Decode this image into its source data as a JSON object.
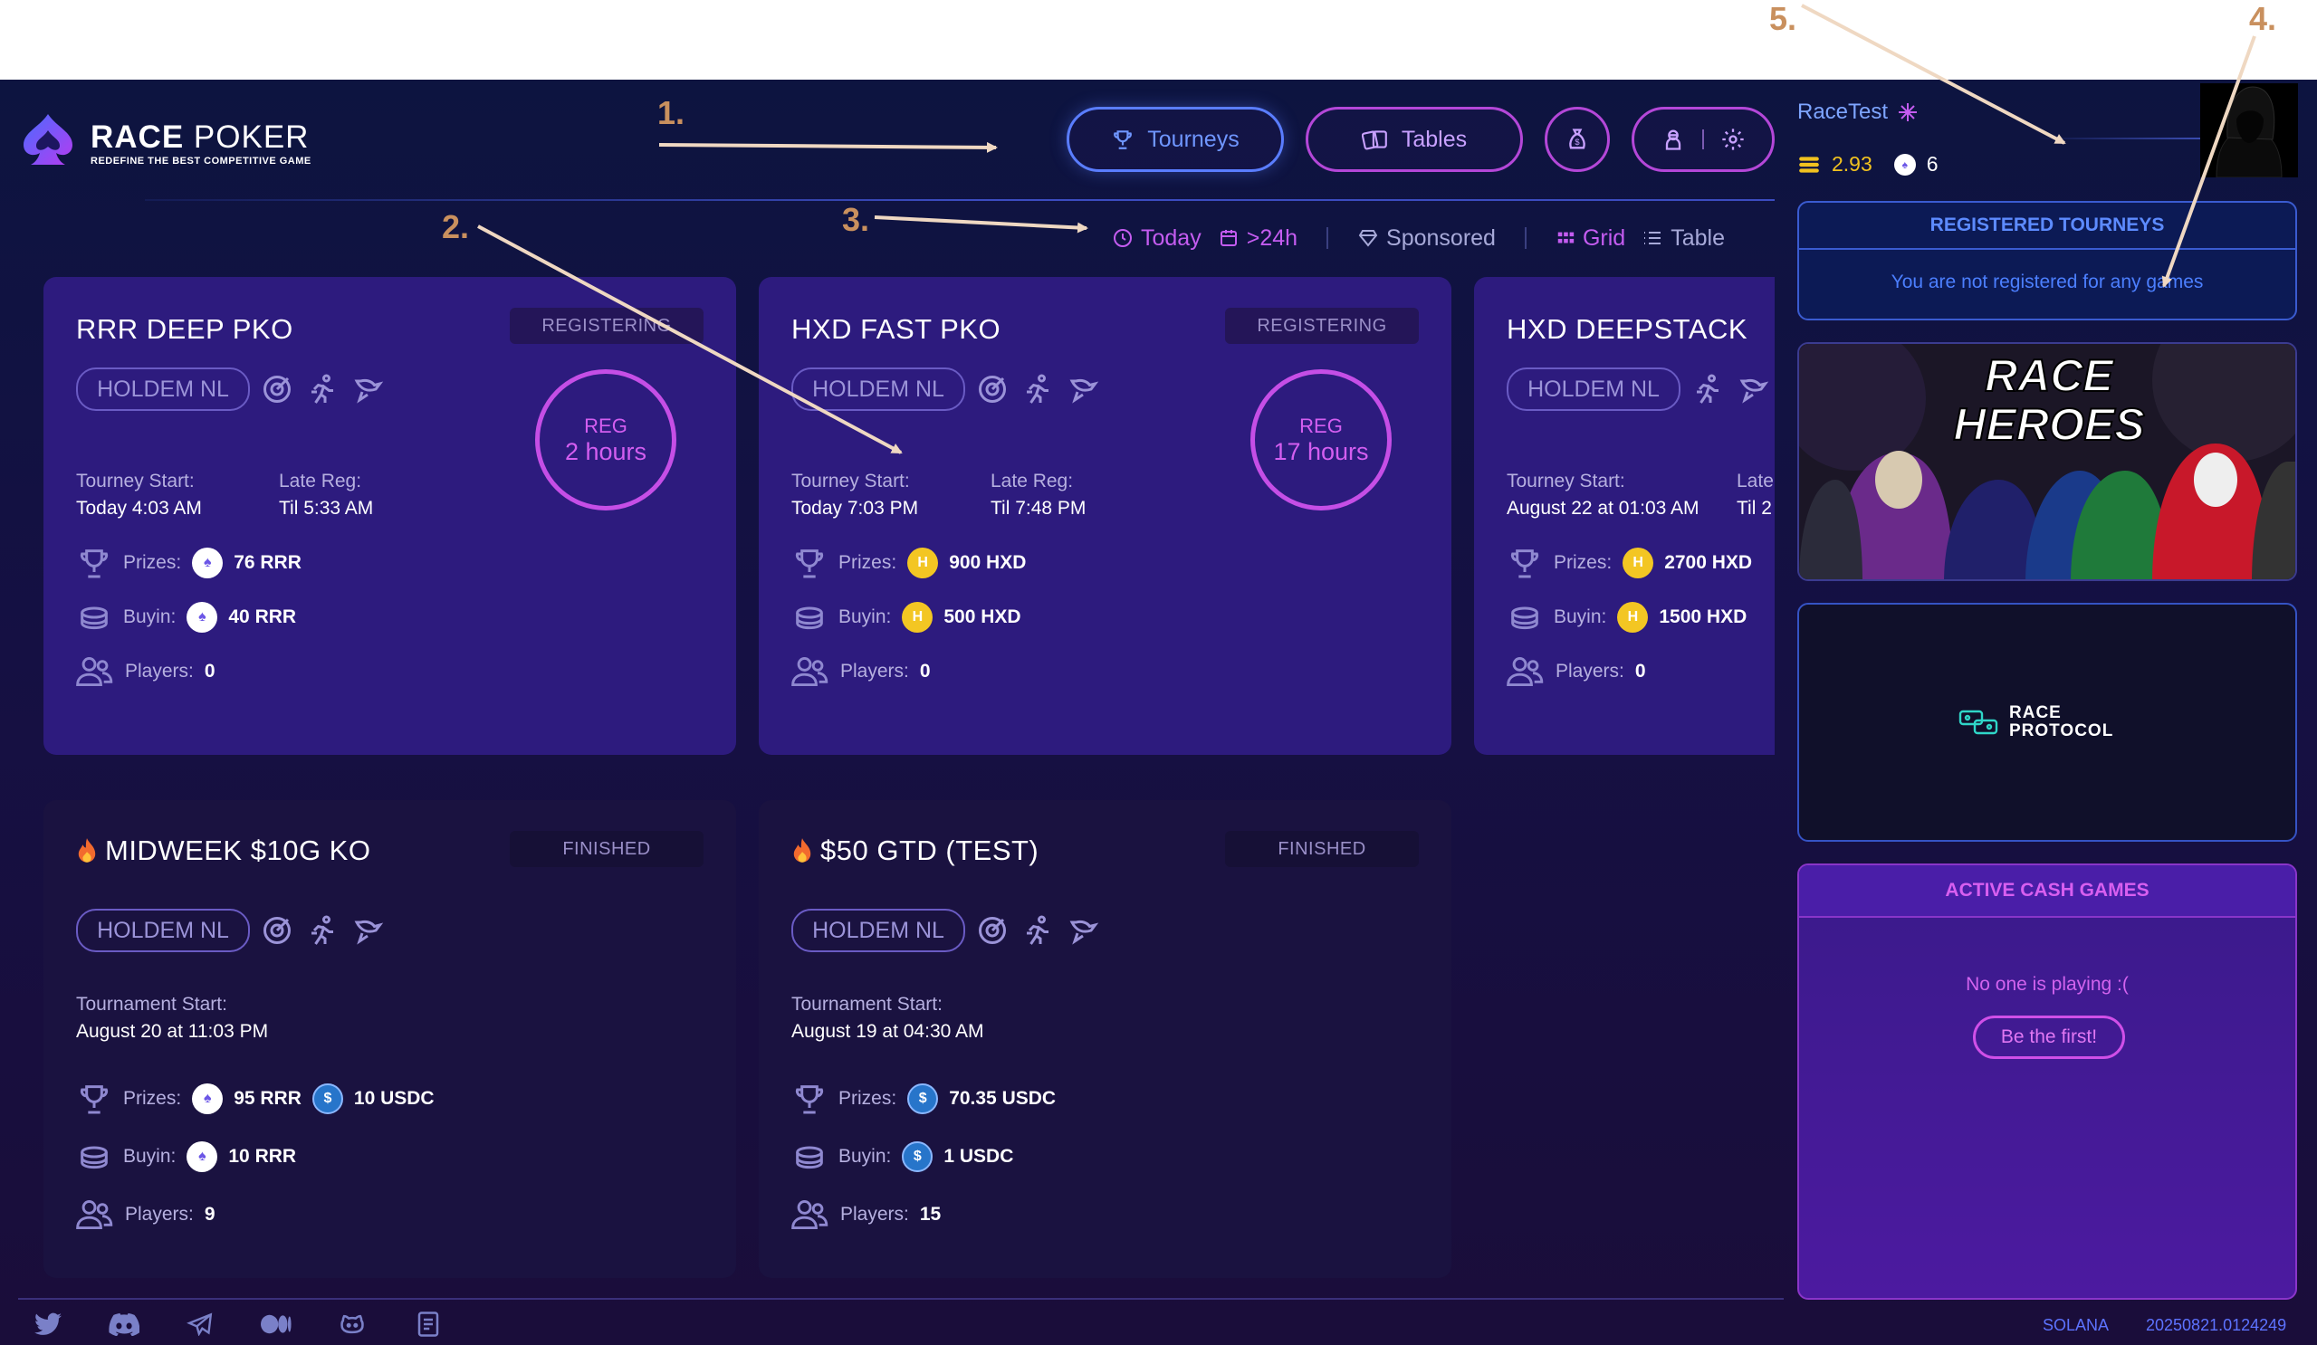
{
  "brand": {
    "title_bold": "RACE",
    "title_rest": " POKER",
    "subtitle": "REDEFINE THE BEST COMPETITIVE GAME"
  },
  "nav": {
    "tourneys": "Tourneys",
    "tables": "Tables"
  },
  "filters": {
    "today": "Today",
    "later": ">24h",
    "sponsored": "Sponsored",
    "grid": "Grid",
    "table": "Table"
  },
  "user": {
    "name": "RaceTest",
    "gold": "2.93",
    "tokens": "6"
  },
  "registered": {
    "title": "REGISTERED TOURNEYS",
    "message": "You are not registered for any games"
  },
  "cash": {
    "title": "ACTIVE CASH GAMES",
    "message": "No one is playing :(",
    "button": "Be the first!"
  },
  "protocol": {
    "line1": "RACE",
    "line2": "PROTOCOL"
  },
  "heroes": {
    "line1": "RACE",
    "line2": "HEROES"
  },
  "cards": [
    {
      "title": "RRR DEEP PKO",
      "status": "REGISTERING",
      "game": "HOLDEM NL",
      "start_label": "Tourney Start:",
      "start": "Today 4:03 AM",
      "late_label": "Late Reg:",
      "late": "Til 5:33 AM",
      "reg_top": "REG",
      "reg_bottom": "2 hours",
      "prizes_label": "Prizes:",
      "prizes": "76 RRR",
      "buyin_label": "Buyin:",
      "buyin": "40 RRR",
      "players_label": "Players:",
      "players": "0"
    },
    {
      "title": "HXD FAST PKO",
      "status": "REGISTERING",
      "game": "HOLDEM NL",
      "start_label": "Tourney Start:",
      "start": "Today 7:03 PM",
      "late_label": "Late Reg:",
      "late": "Til 7:48 PM",
      "reg_top": "REG",
      "reg_bottom": "17 hours",
      "prizes_label": "Prizes:",
      "prizes": "900 HXD",
      "buyin_label": "Buyin:",
      "buyin": "500 HXD",
      "players_label": "Players:",
      "players": "0"
    },
    {
      "title": "HXD DEEPSTACK",
      "game": "HOLDEM NL",
      "start_label": "Tourney Start:",
      "start": "August 22 at 01:03 AM",
      "late_label": "Late",
      "late": "Til 2",
      "prizes_label": "Prizes:",
      "prizes": "2700 HXD",
      "buyin_label": "Buyin:",
      "buyin": "1500 HXD",
      "players_label": "Players:",
      "players": "0"
    },
    {
      "title": "MIDWEEK $10G KO",
      "status": "FINISHED",
      "game": "HOLDEM NL",
      "start_label": "Tournament Start:",
      "start": "August 20 at 11:03 PM",
      "prizes_label": "Prizes:",
      "prizes": "95 RRR",
      "prizes2": "10 USDC",
      "buyin_label": "Buyin:",
      "buyin": "10 RRR",
      "players_label": "Players:",
      "players": "9"
    },
    {
      "title": "$50 GTD (TEST)",
      "status": "FINISHED",
      "game": "HOLDEM NL",
      "start_label": "Tournament Start:",
      "start": "August 19 at 04:30 AM",
      "prizes_label": "Prizes:",
      "prizes": "70.35 USDC",
      "buyin_label": "Buyin:",
      "buyin": "1 USDC",
      "players_label": "Players:",
      "players": "15"
    }
  ],
  "footer": {
    "network": "SOLANA",
    "version": "20250821.0124249"
  },
  "annotations": [
    "1.",
    "2.",
    "3.",
    "4.",
    "5."
  ],
  "colors": {
    "accent_blue": "#5a7dff",
    "accent_purple": "#c54ee6",
    "annotation": "#c9905e"
  }
}
